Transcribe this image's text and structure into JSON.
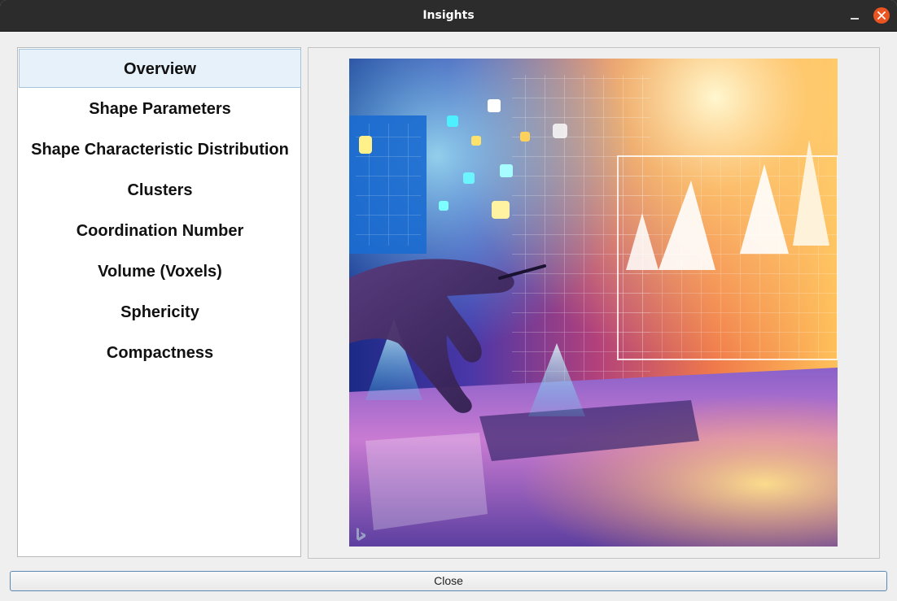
{
  "window": {
    "title": "Insights"
  },
  "sidebar": {
    "items": [
      {
        "label": "Overview",
        "selected": true
      },
      {
        "label": "Shape Parameters",
        "selected": false
      },
      {
        "label": "Shape Characteristic Distribution",
        "selected": false
      },
      {
        "label": "Clusters",
        "selected": false
      },
      {
        "label": "Coordination Number",
        "selected": false
      },
      {
        "label": "Volume (Voxels)",
        "selected": false
      },
      {
        "label": "Sphericity",
        "selected": false
      },
      {
        "label": "Compactness",
        "selected": false
      }
    ]
  },
  "preview": {
    "image": "data-visualization-illustration",
    "watermark_icon": "bing-icon"
  },
  "footer": {
    "close_label": "Close"
  },
  "colors": {
    "accent": "#e95420",
    "selection": "#e6f1fa",
    "titlebar": "#2c2c2c"
  }
}
